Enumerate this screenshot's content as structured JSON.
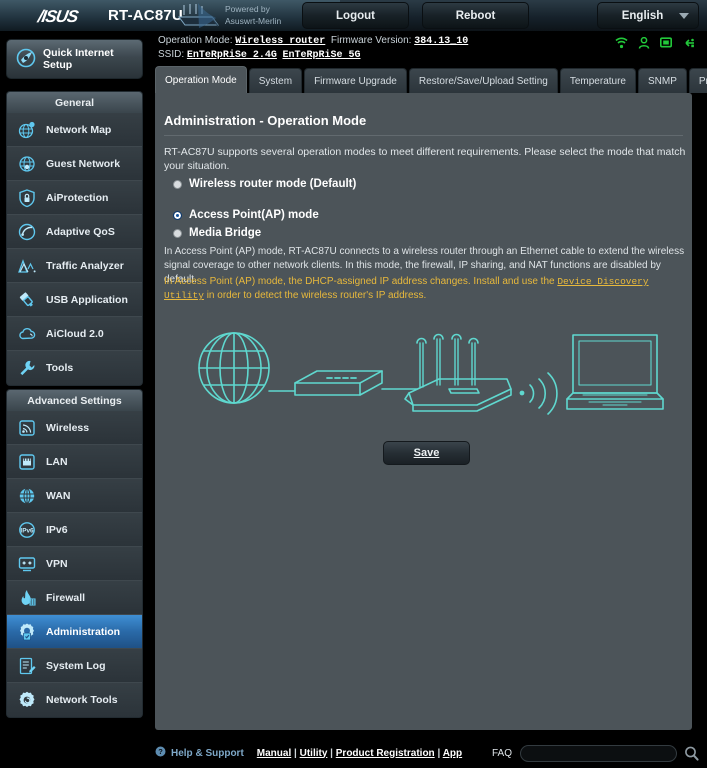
{
  "header": {
    "brand": "/ISUS",
    "model": "RT-AC87U",
    "powered_by_line1": "Powered by",
    "powered_by_line2": "Asuswrt-Merlin",
    "logout_label": "Logout",
    "reboot_label": "Reboot",
    "language": "English",
    "router_icon": "router-image"
  },
  "info": {
    "operation_mode_label": "Operation Mode:",
    "operation_mode_value": "Wireless router",
    "firmware_label": "Firmware Version:",
    "firmware_value": "384.13_10",
    "ssid_label": "SSID:",
    "ssid_24g": "EnTeRpRiSe 2.4G",
    "ssid_5g": "EnTeRpRiSe 5G",
    "status_icons": [
      "wifi-icon",
      "user-icon",
      "monitor-icon",
      "usb-icon"
    ],
    "status_icon_color": "#22c93a"
  },
  "sidebar": {
    "quick_setup_line1": "Quick Internet",
    "quick_setup_line2": "Setup",
    "quick_setup_icon": "qis-icon",
    "groups": [
      {
        "title": "General",
        "items": [
          {
            "label": "Network Map",
            "icon": "network-map-icon",
            "active": false
          },
          {
            "label": "Guest Network",
            "icon": "guest-network-icon",
            "active": false
          },
          {
            "label": "AiProtection",
            "icon": "shield-icon",
            "active": false
          },
          {
            "label": "Adaptive QoS",
            "icon": "speedometer-icon",
            "active": false
          },
          {
            "label": "Traffic Analyzer",
            "icon": "traffic-analyzer-icon",
            "active": false
          },
          {
            "label": "USB Application",
            "icon": "usb-application-icon",
            "active": false
          },
          {
            "label": "AiCloud 2.0",
            "icon": "cloud-icon",
            "active": false
          },
          {
            "label": "Tools",
            "icon": "wrench-icon",
            "active": false
          }
        ]
      },
      {
        "title": "Advanced Settings",
        "items": [
          {
            "label": "Wireless",
            "icon": "wireless-icon",
            "active": false
          },
          {
            "label": "LAN",
            "icon": "lan-icon",
            "active": false
          },
          {
            "label": "WAN",
            "icon": "wan-globe-icon",
            "active": false
          },
          {
            "label": "IPv6",
            "icon": "ipv6-icon",
            "active": false
          },
          {
            "label": "VPN",
            "icon": "vpn-icon",
            "active": false
          },
          {
            "label": "Firewall",
            "icon": "firewall-icon",
            "active": false
          },
          {
            "label": "Administration",
            "icon": "gear-icon",
            "active": true
          },
          {
            "label": "System Log",
            "icon": "system-log-icon",
            "active": false
          },
          {
            "label": "Network Tools",
            "icon": "network-tools-icon",
            "active": false
          }
        ]
      }
    ]
  },
  "tabs": [
    {
      "label": "Operation Mode",
      "active": true
    },
    {
      "label": "System",
      "active": false
    },
    {
      "label": "Firmware Upgrade",
      "active": false
    },
    {
      "label": "Restore/Save/Upload Setting",
      "active": false
    },
    {
      "label": "Temperature",
      "active": false
    },
    {
      "label": "SNMP",
      "active": false
    },
    {
      "label": "Privacy",
      "active": false
    }
  ],
  "main": {
    "page_title": "Administration - Operation Mode",
    "intro": "RT-AC87U supports several operation modes to meet different requirements. Please select the mode that match your situation.",
    "modes": [
      {
        "label": "Wireless router mode (Default)",
        "selected": false
      },
      {
        "label": "Access Point(AP) mode",
        "selected": true
      },
      {
        "label": "Media Bridge",
        "selected": false
      }
    ],
    "description_white": "In Access Point (AP) mode, RT-AC87U connects to a wireless router through an Ethernet cable to extend the wireless signal coverage to other network clients. In this mode, the firewall, IP sharing, and NAT functions are disabled by default.",
    "description_yellow_pre": "In Access Point (AP) mode, the DHCP-assigned IP address changes. Install and use the ",
    "description_yellow_link": "Device Discovery Utility",
    "description_yellow_post": " in order to detect the wireless router's IP address.",
    "diagram_nodes": [
      "globe-icon",
      "modem-icon",
      "router-icon",
      "wifi-waves-icon",
      "laptop-icon"
    ],
    "diagram_color": "#5fd8cf",
    "save_label": "Save"
  },
  "footer": {
    "help_icon": "help-icon",
    "help_label": "Help & Support",
    "links": [
      "Manual",
      "Utility",
      "Product Registration",
      "App"
    ],
    "separator": "|",
    "faq_label": "FAQ",
    "faq_value": "",
    "faq_placeholder": "",
    "search_icon": "search-icon"
  },
  "colors": {
    "accent_blue": "#2a6aa8",
    "panel_bg": "#4c5459",
    "status_green": "#22c93a",
    "warning_yellow": "#e8b93c",
    "diagram_cyan": "#5fd8cf"
  }
}
